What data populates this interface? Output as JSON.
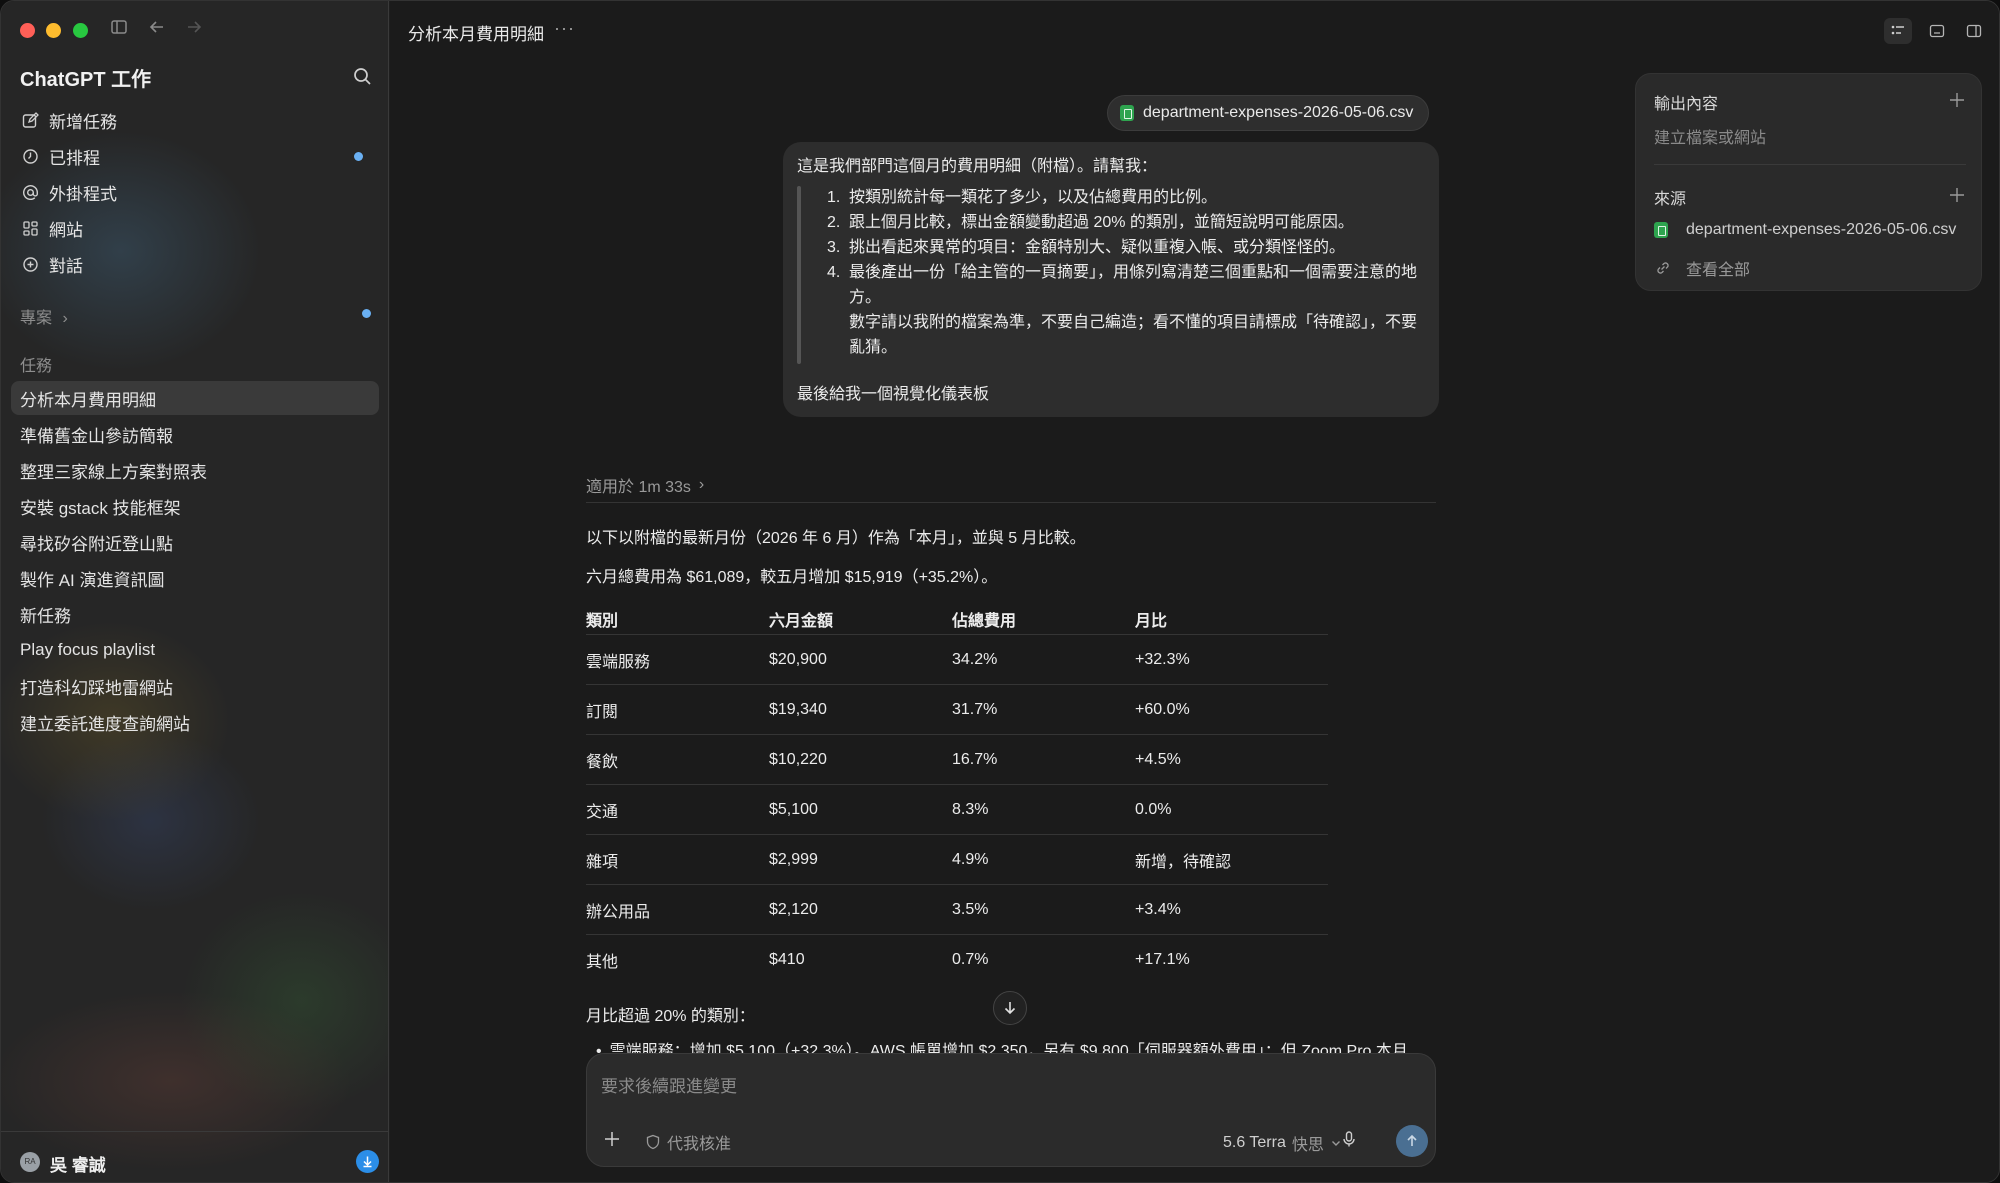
{
  "sidebar": {
    "app_title": "ChatGPT 工作",
    "nav": [
      {
        "label": "新增任務",
        "icon": "edit-icon"
      },
      {
        "label": "已排程",
        "icon": "clock-icon"
      },
      {
        "label": "外掛程式",
        "icon": "at-icon"
      },
      {
        "label": "網站",
        "icon": "grid-icon"
      },
      {
        "label": "對話",
        "icon": "plus-circle-icon"
      }
    ],
    "projects_label": "專案",
    "tasks_label": "任務",
    "tasks": [
      "分析本月費用明細",
      "準備舊金山參訪簡報",
      "整理三家線上方案對照表",
      "安裝 gstack 技能框架",
      "尋找矽谷附近登山點",
      "製作 AI 演進資訊圖",
      "新任務",
      "Play focus playlist",
      "打造科幻踩地雷網站",
      "建立委託進度查詢網站"
    ],
    "user": {
      "initials": "RA",
      "name": "吳 睿誠"
    }
  },
  "header": {
    "title": "分析本月費用明細",
    "more": "···"
  },
  "message": {
    "attachment": "department-expenses-2026-05-06.csv",
    "intro": "這是我們部門這個月的費用明細（附檔）。請幫我：",
    "items": [
      {
        "num": "1.",
        "text": "按類別統計每一類花了多少，以及佔總費用的比例。"
      },
      {
        "num": "2.",
        "text": "跟上個月比較，標出金額變動超過 20% 的類別，並簡短說明可能原因。"
      },
      {
        "num": "3.",
        "text": "挑出看起來異常的項目：金額特別大、疑似重複入帳、或分類怪怪的。"
      },
      {
        "num": "4.",
        "text": "最後產出一份「給主管的一頁摘要」，用條列寫清楚三個重點和一個需要注意的地方。"
      }
    ],
    "note": "數字請以我附的檔案為準，不要自己編造；看不懂的項目請標成「待確認」，不要亂猜。",
    "outro": "最後給我一個視覺化儀表板"
  },
  "response": {
    "thought": "適用於 1m 33s",
    "p1": "以下以附檔的最新月份（2026 年 6 月）作為「本月」，並與 5 月比較。",
    "p2": "六月總費用為 $61,089，較五月增加 $15,919（+35.2%）。",
    "table": {
      "headers": [
        "類別",
        "六月金額",
        "佔總費用",
        "月比"
      ],
      "rows": [
        [
          "雲端服務",
          "$20,900",
          "34.2%",
          "+32.3%"
        ],
        [
          "訂閱",
          "$19,340",
          "31.7%",
          "+60.0%"
        ],
        [
          "餐飲",
          "$10,220",
          "16.7%",
          "+4.5%"
        ],
        [
          "交通",
          "$5,100",
          "8.3%",
          "0.0%"
        ],
        [
          "雜項",
          "$2,999",
          "4.9%",
          "新增，待確認"
        ],
        [
          "辦公用品",
          "$2,120",
          "3.5%",
          "+3.4%"
        ],
        [
          "其他",
          "$410",
          "0.7%",
          "+17.1%"
        ]
      ]
    },
    "p3": "月比超過 20% 的類別：",
    "bullet": "雲端服務：增加 $5,100（+32.3%）。AWS 帳單增加 $2,350，另有 $9,800「伺服器額外費用」；但 Zoom Pro 本月"
  },
  "composer": {
    "placeholder": "要求後續跟進變更",
    "approve_label": "代我核准",
    "model": "5.6 Terra",
    "speed": "快思"
  },
  "right_panel": {
    "output_title": "輸出內容",
    "output_sub": "建立檔案或網站",
    "sources_title": "來源",
    "source_file": "department-expenses-2026-05-06.csv",
    "view_all": "查看全部"
  }
}
